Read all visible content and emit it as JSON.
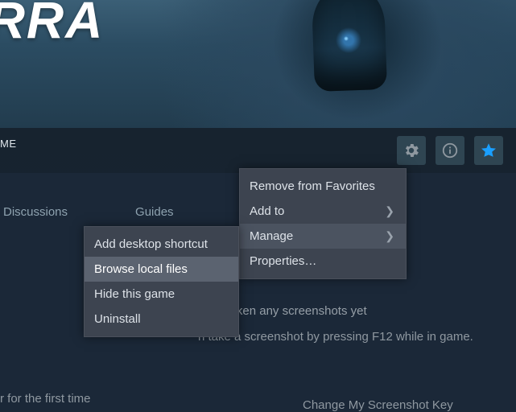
{
  "hero": {
    "title_fragment": "ERRA"
  },
  "header": {
    "me_label": "ME",
    "icons": {
      "gear": "settings",
      "info": "info",
      "star": "favorite"
    }
  },
  "tabs": {
    "discussions": "Discussions",
    "guides": "Guides"
  },
  "screenshots": {
    "line1": "ven't taken any screenshots yet",
    "line2": "n take a screenshot by pressing F12 while in game.",
    "change_key": "Change My Screenshot Key"
  },
  "first_time": "r for the first time",
  "context_menu": {
    "remove_favorites": "Remove from Favorites",
    "add_to": "Add to",
    "manage": "Manage",
    "properties": "Properties…"
  },
  "manage_submenu": {
    "add_shortcut": "Add desktop shortcut",
    "browse_local": "Browse local files",
    "hide_game": "Hide this game",
    "uninstall": "Uninstall"
  }
}
